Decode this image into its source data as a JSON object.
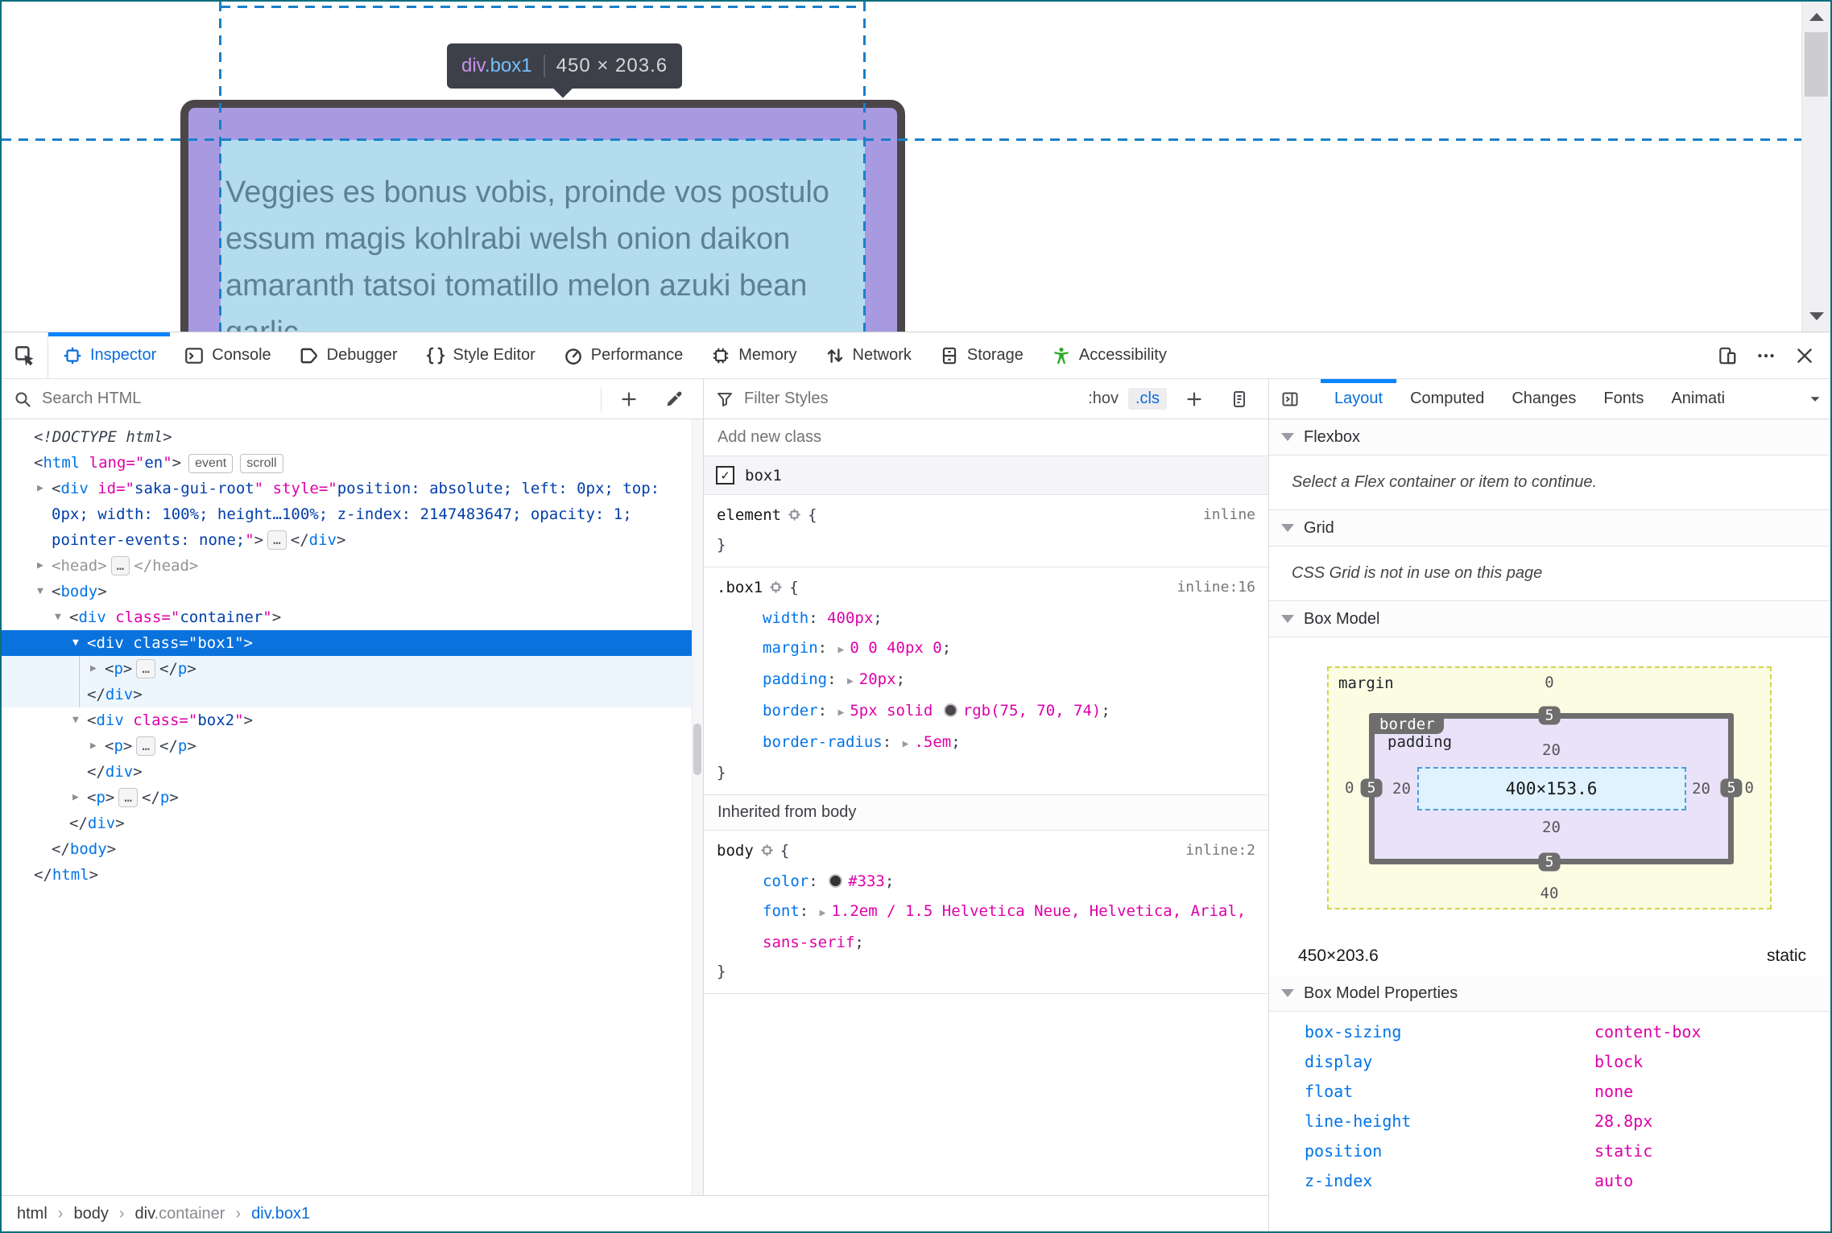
{
  "colors": {
    "accent": "#0a84ff",
    "selection_blue": "#0a72dd",
    "accessibility_green": "#2bab26",
    "box_border": "#4b464a",
    "padding_highlight": "#a89ae1",
    "content_highlight": "#b3dcef",
    "guide_blue": "#1a80c8",
    "window_border": "#0c6e7d"
  },
  "viewport": {
    "tooltip": {
      "tag": "div",
      "cls": ".box1",
      "size": "450 × 203.6"
    },
    "box_text_lines": [
      "Veggies es bonus vobis, proinde vos postulo",
      "essum magis kohlrabi welsh onion daikon",
      "amaranth tatsoi tomatillo melon azuki bean",
      "garlic"
    ]
  },
  "tabbar": {
    "tabs": [
      {
        "id": "inspector",
        "label": "Inspector",
        "active": true
      },
      {
        "id": "console",
        "label": "Console"
      },
      {
        "id": "debugger",
        "label": "Debugger"
      },
      {
        "id": "style-editor",
        "label": "Style Editor"
      },
      {
        "id": "performance",
        "label": "Performance"
      },
      {
        "id": "memory",
        "label": "Memory"
      },
      {
        "id": "network",
        "label": "Network"
      },
      {
        "id": "storage",
        "label": "Storage"
      },
      {
        "id": "accessibility",
        "label": "Accessibility",
        "a11y": true
      }
    ]
  },
  "markup": {
    "search_placeholder": "Search HTML",
    "rows": [
      {
        "indent": 0,
        "seg": [
          [
            "doctype",
            "<!DOCTYPE html>"
          ]
        ]
      },
      {
        "indent": 0,
        "seg": [
          [
            "p",
            "<"
          ],
          [
            "t",
            "html"
          ],
          [
            "p",
            " "
          ],
          [
            "a",
            "lang=\""
          ],
          [
            "v",
            "en"
          ],
          [
            "a",
            "\""
          ],
          [
            "p",
            ">"
          ]
        ],
        "pills": [
          "event",
          "scroll"
        ]
      },
      {
        "indent": 1,
        "arrow": "r",
        "seg": [
          [
            "p",
            "<"
          ],
          [
            "t",
            "div"
          ],
          [
            "p",
            " "
          ],
          [
            "a",
            "id=\""
          ],
          [
            "v",
            "saka-gui-root"
          ],
          [
            "a",
            "\""
          ],
          [
            "p",
            " "
          ],
          [
            "a",
            "style=\""
          ],
          [
            "v",
            "position: absolute; left: 0px; top: 0px; width: 100%; height…100%; z-index: 2147483647; opacity: 1; pointer-events: none;"
          ],
          [
            "a",
            "\""
          ],
          [
            "p",
            ">"
          ],
          [
            "badge",
            "…"
          ],
          [
            "p",
            "</"
          ],
          [
            "t",
            "div"
          ],
          [
            "p",
            ">"
          ]
        ]
      },
      {
        "indent": 1,
        "arrow": "r",
        "seg": [
          [
            "d",
            "<head>"
          ],
          [
            "badge",
            "…"
          ],
          [
            "d",
            "</head>"
          ]
        ]
      },
      {
        "indent": 1,
        "arrow": "d",
        "seg": [
          [
            "p",
            "<"
          ],
          [
            "t",
            "body"
          ],
          [
            "p",
            ">"
          ]
        ]
      },
      {
        "indent": 2,
        "arrow": "d",
        "seg": [
          [
            "p",
            "<"
          ],
          [
            "t",
            "div"
          ],
          [
            "p",
            " "
          ],
          [
            "a",
            "class=\""
          ],
          [
            "v",
            "container"
          ],
          [
            "a",
            "\""
          ],
          [
            "p",
            ">"
          ]
        ]
      },
      {
        "indent": 3,
        "arrow": "d",
        "sel": true,
        "seg": [
          [
            "p",
            "<"
          ],
          [
            "t",
            "div"
          ],
          [
            "p",
            " "
          ],
          [
            "a",
            "class=\""
          ],
          [
            "v",
            "box1"
          ],
          [
            "a",
            "\""
          ],
          [
            "p",
            ">"
          ]
        ]
      },
      {
        "indent": 4,
        "arrow": "r",
        "hl": true,
        "seg": [
          [
            "p",
            "<"
          ],
          [
            "t",
            "p"
          ],
          [
            "p",
            ">"
          ],
          [
            "badge",
            "…"
          ],
          [
            "p",
            "</"
          ],
          [
            "t",
            "p"
          ],
          [
            "p",
            ">"
          ]
        ]
      },
      {
        "indent": 3,
        "hl": true,
        "seg": [
          [
            "p",
            "</"
          ],
          [
            "t",
            "div"
          ],
          [
            "p",
            ">"
          ]
        ]
      },
      {
        "indent": 3,
        "arrow": "d",
        "seg": [
          [
            "p",
            "<"
          ],
          [
            "t",
            "div"
          ],
          [
            "p",
            " "
          ],
          [
            "a",
            "class=\""
          ],
          [
            "v",
            "box2"
          ],
          [
            "a",
            "\""
          ],
          [
            "p",
            ">"
          ]
        ]
      },
      {
        "indent": 4,
        "arrow": "r",
        "seg": [
          [
            "p",
            "<"
          ],
          [
            "t",
            "p"
          ],
          [
            "p",
            ">"
          ],
          [
            "badge",
            "…"
          ],
          [
            "p",
            "</"
          ],
          [
            "t",
            "p"
          ],
          [
            "p",
            ">"
          ]
        ]
      },
      {
        "indent": 3,
        "seg": [
          [
            "p",
            "</"
          ],
          [
            "t",
            "div"
          ],
          [
            "p",
            ">"
          ]
        ]
      },
      {
        "indent": 3,
        "arrow": "r",
        "seg": [
          [
            "p",
            "<"
          ],
          [
            "t",
            "p"
          ],
          [
            "p",
            ">"
          ],
          [
            "badge",
            "…"
          ],
          [
            "p",
            "</"
          ],
          [
            "t",
            "p"
          ],
          [
            "p",
            ">"
          ]
        ]
      },
      {
        "indent": 2,
        "seg": [
          [
            "p",
            "</"
          ],
          [
            "t",
            "div"
          ],
          [
            "p",
            ">"
          ]
        ]
      },
      {
        "indent": 1,
        "seg": [
          [
            "p",
            "</"
          ],
          [
            "t",
            "body"
          ],
          [
            "p",
            ">"
          ]
        ]
      },
      {
        "indent": 0,
        "seg": [
          [
            "p",
            "</"
          ],
          [
            "t",
            "html"
          ],
          [
            "p",
            ">"
          ]
        ]
      }
    ],
    "breadcrumbs": [
      {
        "text": "html"
      },
      {
        "text": "body"
      },
      {
        "text": "div",
        "muted": ".container"
      },
      {
        "text": "div.box1",
        "active": true
      }
    ]
  },
  "styles": {
    "filter_placeholder": "Filter Styles",
    "pseudo_label": ":hov",
    "class_label": ".cls",
    "add_class_placeholder": "Add new class",
    "class_toggle": "box1",
    "rules": [
      {
        "selector": "element",
        "link": "inline",
        "props": []
      },
      {
        "selector": ".box1",
        "link": "inline:16",
        "props": [
          {
            "name": "width",
            "value": "400px"
          },
          {
            "name": "margin",
            "arrow": true,
            "value": "0 0 40px 0"
          },
          {
            "name": "padding",
            "arrow": true,
            "value": "20px"
          },
          {
            "name": "border",
            "arrow": true,
            "pre": "5px solid ",
            "swatch": "#4b464a",
            "value": "rgb(75, 70, 74)"
          },
          {
            "name": "border-radius",
            "arrow": true,
            "value": ".5em"
          }
        ]
      }
    ],
    "inherited_header": "Inherited from body",
    "inherited_rules": [
      {
        "selector": "body",
        "link": "inline:2",
        "props": [
          {
            "name": "color",
            "swatch": "#333333",
            "value": "#333"
          },
          {
            "name": "font",
            "arrow": true,
            "value": "1.2em / 1.5 Helvetica Neue, Helvetica, Arial, sans-serif"
          }
        ]
      }
    ]
  },
  "layout": {
    "tabs": [
      {
        "label": "Layout",
        "active": true
      },
      {
        "label": "Computed"
      },
      {
        "label": "Changes"
      },
      {
        "label": "Fonts"
      },
      {
        "label": "Animati"
      }
    ],
    "flexbox_label": "Flexbox",
    "flexbox_message": "Select a Flex container or item to continue.",
    "grid_label": "Grid",
    "grid_message": "CSS Grid is not in use on this page",
    "boxmodel_label": "Box Model",
    "diagram": {
      "margin_label": "margin",
      "border_label": "border",
      "padding_label": "padding",
      "content": "400×153.6",
      "margin": {
        "top": "0",
        "right": "0",
        "bottom": "40",
        "left": "0"
      },
      "border": {
        "top": "5",
        "right": "5",
        "bottom": "5",
        "left": "5"
      },
      "padding": {
        "top": "20",
        "right": "20",
        "bottom": "20",
        "left": "20"
      }
    },
    "element_size": "450×203.6",
    "position": "static",
    "properties_label": "Box Model Properties",
    "properties": [
      {
        "name": "box-sizing",
        "value": "content-box"
      },
      {
        "name": "display",
        "value": "block"
      },
      {
        "name": "float",
        "value": "none"
      },
      {
        "name": "line-height",
        "value": "28.8px"
      },
      {
        "name": "position",
        "value": "static"
      },
      {
        "name": "z-index",
        "value": "auto"
      }
    ]
  }
}
